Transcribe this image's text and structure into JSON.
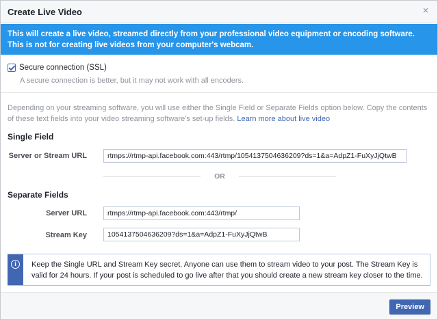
{
  "dialog": {
    "title": "Create Live Video",
    "close_glyph": "×"
  },
  "banner": {
    "text": "This will create a live video, streamed directly from your professional video equipment or encoding software. This is not for creating live videos from your computer's webcam."
  },
  "ssl": {
    "checked": true,
    "label": "Secure connection (SSL)",
    "hint": "A secure connection is better, but it may not work with all encoders."
  },
  "description": {
    "text": "Depending on your streaming software, you will use either the Single Field or Separate Fields option below. Copy the contents of these text fields into your video streaming software's set-up fields. ",
    "link": "Learn more about live video"
  },
  "single_field": {
    "title": "Single Field",
    "label": "Server or Stream URL",
    "value": "rtmps://rtmp-api.facebook.com:443/rtmp/1054137504636209?ds=1&a=AdpZ1-FuXyJjQtwB"
  },
  "or_text": "OR",
  "separate_fields": {
    "title": "Separate Fields",
    "server_label": "Server URL",
    "server_value": "rtmps://rtmp-api.facebook.com:443/rtmp/",
    "key_label": "Stream Key",
    "key_value": "1054137504636209?ds=1&a=AdpZ1-FuXyJjQtwB"
  },
  "info": {
    "text": "Keep the Single URL and Stream Key secret. Anyone can use them to stream video to your post. The Stream Key is valid for 24 hours. If your post is scheduled to go live after that you should create a new stream key closer to the time."
  },
  "footer": {
    "preview_label": "Preview"
  },
  "colors": {
    "banner": "#2795e9",
    "accent": "#4267b2"
  }
}
